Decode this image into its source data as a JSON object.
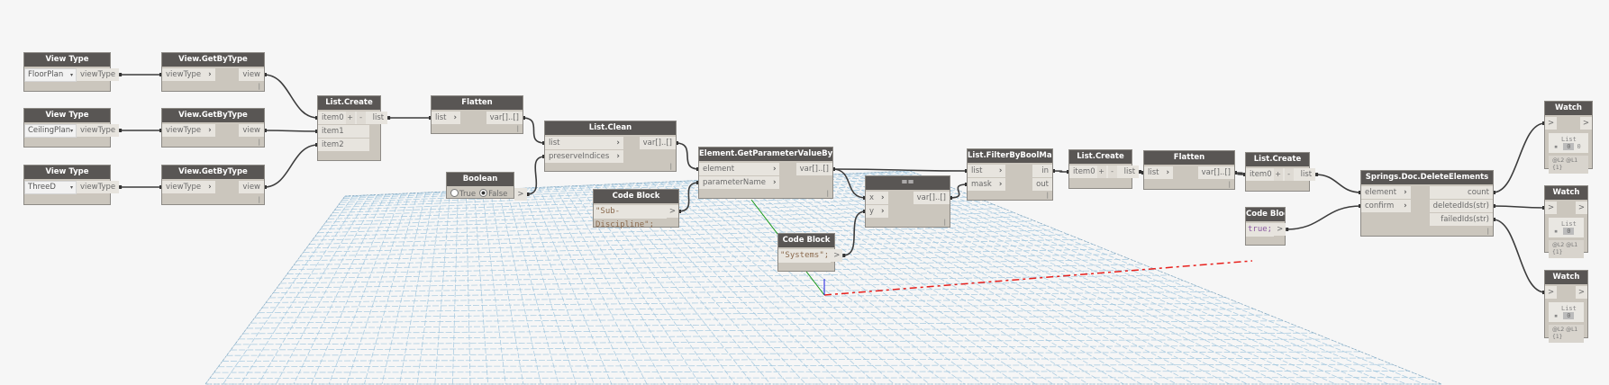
{
  "colors": {
    "header": "#595654",
    "body": "#cbc6bd",
    "wire": "#3c3c3c",
    "selected_wire": "#e8201c",
    "grid": "#9cc3dc",
    "axis_x": "#e8201c",
    "axis_y": "#1a9a1a",
    "axis_z": "#1a1ae0"
  },
  "nodes": [
    {
      "id": "vt1",
      "title": "View Type",
      "kind": "dropdown",
      "value": "FloorPlan",
      "outputs": [
        "viewType"
      ]
    },
    {
      "id": "gbt1",
      "title": "View.GetByType",
      "inputs": [
        "viewType"
      ],
      "outputs": [
        "view"
      ]
    },
    {
      "id": "vt2",
      "title": "View Type",
      "kind": "dropdown",
      "value": "CeilingPlan",
      "outputs": [
        "viewType"
      ]
    },
    {
      "id": "gbt2",
      "title": "View.GetByType",
      "inputs": [
        "viewType"
      ],
      "outputs": [
        "view"
      ]
    },
    {
      "id": "vt3",
      "title": "View Type",
      "kind": "dropdown",
      "value": "ThreeD",
      "outputs": [
        "viewType"
      ]
    },
    {
      "id": "gbt3",
      "title": "View.GetByType",
      "inputs": [
        "viewType"
      ],
      "outputs": [
        "view"
      ]
    },
    {
      "id": "lc1",
      "title": "List.Create",
      "kind": "listcreate",
      "inputs": [
        "item0",
        "item1",
        "item2"
      ],
      "outputs": [
        "list"
      ],
      "add": "+",
      "remove": "-"
    },
    {
      "id": "fl1",
      "title": "Flatten",
      "inputs": [
        "list"
      ],
      "outputs": [
        "var[]..[]"
      ]
    },
    {
      "id": "bool",
      "title": "Boolean",
      "kind": "boolean",
      "options": [
        "True",
        "False"
      ],
      "selected": "False",
      "outputs": [
        ">"
      ]
    },
    {
      "id": "clean",
      "title": "List.Clean",
      "inputs": [
        "list",
        "preserveIndices"
      ],
      "outputs": [
        "var[]..[]"
      ]
    },
    {
      "id": "cb1",
      "title": "Code Block",
      "kind": "code",
      "code": "\"Sub-Discipline\";",
      "outputs": [
        ">"
      ]
    },
    {
      "id": "gpv",
      "title": "Element.GetParameterValueByName",
      "inputs": [
        "element",
        "parameterName"
      ],
      "outputs": [
        "var[]..[]"
      ]
    },
    {
      "id": "eq",
      "title": "==",
      "inputs": [
        "x",
        "y"
      ],
      "outputs": [
        "var[]..[]"
      ]
    },
    {
      "id": "cb2",
      "title": "Code Block",
      "kind": "code",
      "code": "\"Systems\";",
      "outputs": [
        ">"
      ]
    },
    {
      "id": "fbm",
      "title": "List.FilterByBoolMask",
      "inputs": [
        "list",
        "mask"
      ],
      "outputs": [
        "in",
        "out"
      ]
    },
    {
      "id": "lc2",
      "title": "List.Create",
      "kind": "listcreate",
      "inputs": [
        "item0"
      ],
      "outputs": [
        "list"
      ],
      "add": "+",
      "remove": "-"
    },
    {
      "id": "fl2",
      "title": "Flatten",
      "inputs": [
        "list"
      ],
      "outputs": [
        "var[]..[]"
      ]
    },
    {
      "id": "lc3",
      "title": "List.Create",
      "kind": "listcreate",
      "inputs": [
        "item0"
      ],
      "outputs": [
        "list"
      ],
      "add": "+",
      "remove": "-"
    },
    {
      "id": "cb3",
      "title": "Code Block",
      "kind": "code",
      "keyword": true,
      "code": "true;",
      "outputs": [
        ">"
      ]
    },
    {
      "id": "sde",
      "title": "Springs.Doc.DeleteElements",
      "inputs": [
        "element",
        "confirm"
      ],
      "outputs": [
        "count",
        "deletedIds(str)",
        "failedIds(str)"
      ]
    },
    {
      "id": "w1",
      "title": "Watch",
      "kind": "watch",
      "inputs": [
        ">"
      ],
      "outputs": [
        ">"
      ],
      "list_label": "List",
      "index": "0",
      "value": "0",
      "footer": "@L2 @L1 {1}"
    },
    {
      "id": "w2",
      "title": "Watch",
      "kind": "watch",
      "inputs": [
        ">"
      ],
      "outputs": [
        ">"
      ],
      "list_label": "List",
      "index": "0",
      "value": "",
      "footer": "@L2 @L1 {1}"
    },
    {
      "id": "w3",
      "title": "Watch",
      "kind": "watch",
      "inputs": [
        ">"
      ],
      "outputs": [
        ">"
      ],
      "list_label": "List",
      "index": "0",
      "value": "",
      "footer": "@L2 @L1 {1}"
    }
  ],
  "connections": [
    [
      "vt1.0",
      "gbt1.0"
    ],
    [
      "vt2.0",
      "gbt2.0"
    ],
    [
      "vt3.0",
      "gbt3.0"
    ],
    [
      "gbt1.0",
      "lc1.0"
    ],
    [
      "gbt2.0",
      "lc1.1"
    ],
    [
      "gbt3.0",
      "lc1.2"
    ],
    [
      "lc1.0",
      "fl1.0"
    ],
    [
      "fl1.0",
      "clean.0"
    ],
    [
      "bool.0",
      "clean.1"
    ],
    [
      "clean.0",
      "gpv.0"
    ],
    [
      "cb1.0",
      "gpv.1"
    ],
    [
      "gpv.0",
      "fbm.0"
    ],
    [
      "gpv.0",
      "eq.0"
    ],
    [
      "cb2.0",
      "eq.1"
    ],
    [
      "eq.0",
      "fbm.1"
    ],
    [
      "fbm.0",
      "lc2.0"
    ],
    [
      "lc2.0",
      "fl2.0"
    ],
    [
      "fl2.0",
      "lc3.0"
    ],
    [
      "lc3.0",
      "sde.0"
    ],
    [
      "cb3.0",
      "sde.1"
    ],
    [
      "sde.0",
      "w1.0"
    ],
    [
      "sde.1",
      "w2.0"
    ],
    [
      "sde.2",
      "w3.0"
    ]
  ],
  "selected_connection": [
    "clean.0",
    "fbm.0"
  ]
}
